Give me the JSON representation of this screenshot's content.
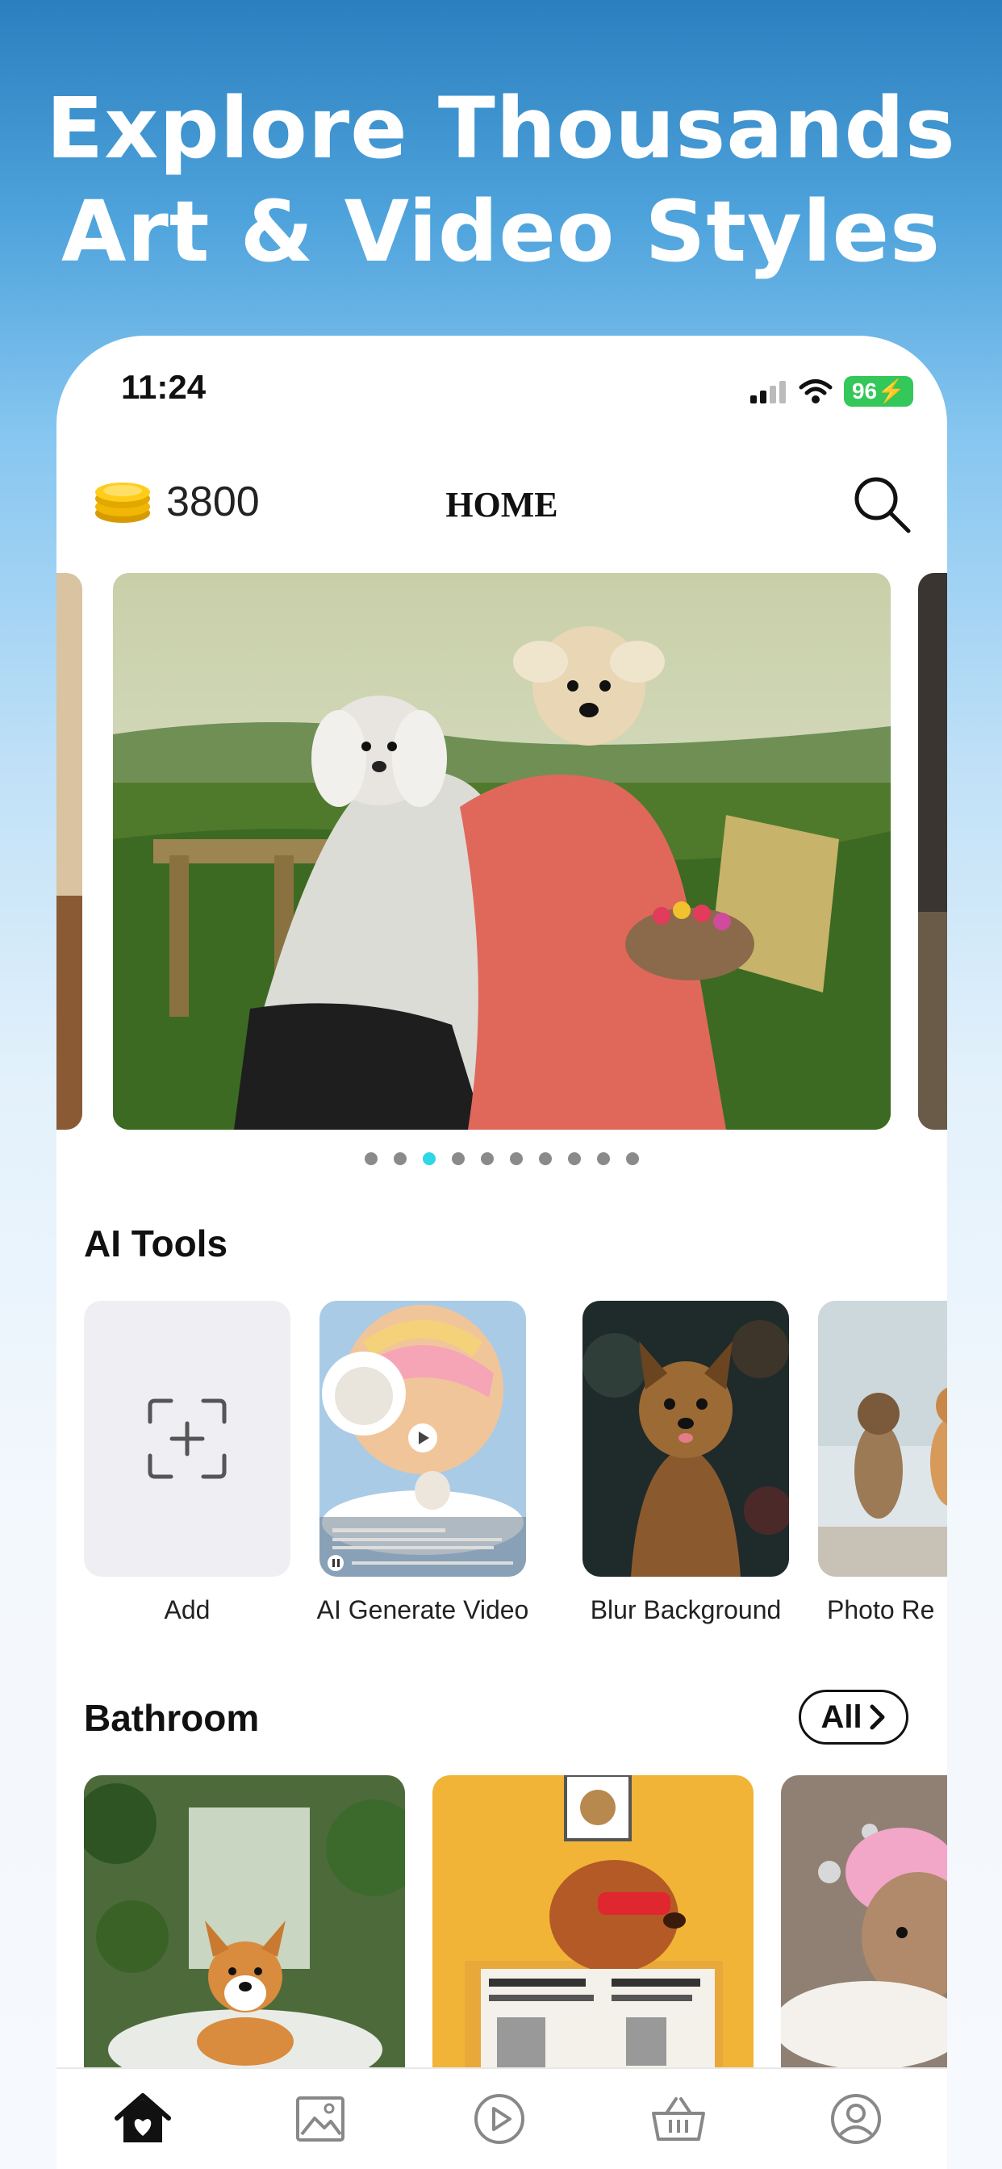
{
  "headline": {
    "line1": "Explore Thousands",
    "line2": "Art & Video Styles"
  },
  "status_bar": {
    "time": "11:24",
    "battery": "96"
  },
  "header": {
    "coins": "3800",
    "title": "HOME",
    "icons": [
      "coin-stack-icon",
      "search-icon"
    ]
  },
  "carousel": {
    "page_count": 10,
    "active_index": 2,
    "accent_color": "#2fd6e6"
  },
  "ai_tools": {
    "title": "AI Tools",
    "items": [
      {
        "label": "Add"
      },
      {
        "label": "AI Generate Video"
      },
      {
        "label": "Blur Background"
      },
      {
        "label": "Photo Re"
      }
    ]
  },
  "bathroom": {
    "title": "Bathroom",
    "all_label": "All"
  },
  "tab_bar": {
    "icons": [
      "home-icon",
      "gallery-icon",
      "play-icon",
      "basket-icon",
      "profile-icon"
    ],
    "active": "home-icon"
  }
}
